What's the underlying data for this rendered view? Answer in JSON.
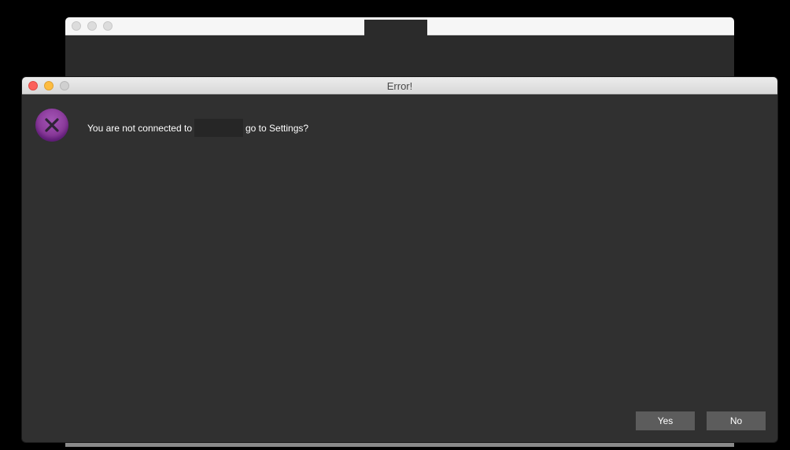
{
  "background_window": {
    "title": ""
  },
  "dialog": {
    "title": "Error!",
    "icon": "error-x-icon",
    "message_prefix": "You are not connected to",
    "message_suffix": "go to Settings?",
    "buttons": {
      "yes": "Yes",
      "no": "No"
    }
  },
  "colors": {
    "dialog_background": "#303030",
    "button_background": "#5c5c5c",
    "icon_purple": "#8a3a9a",
    "close_red": "#fc605b",
    "minimize_yellow": "#fdbc40"
  }
}
